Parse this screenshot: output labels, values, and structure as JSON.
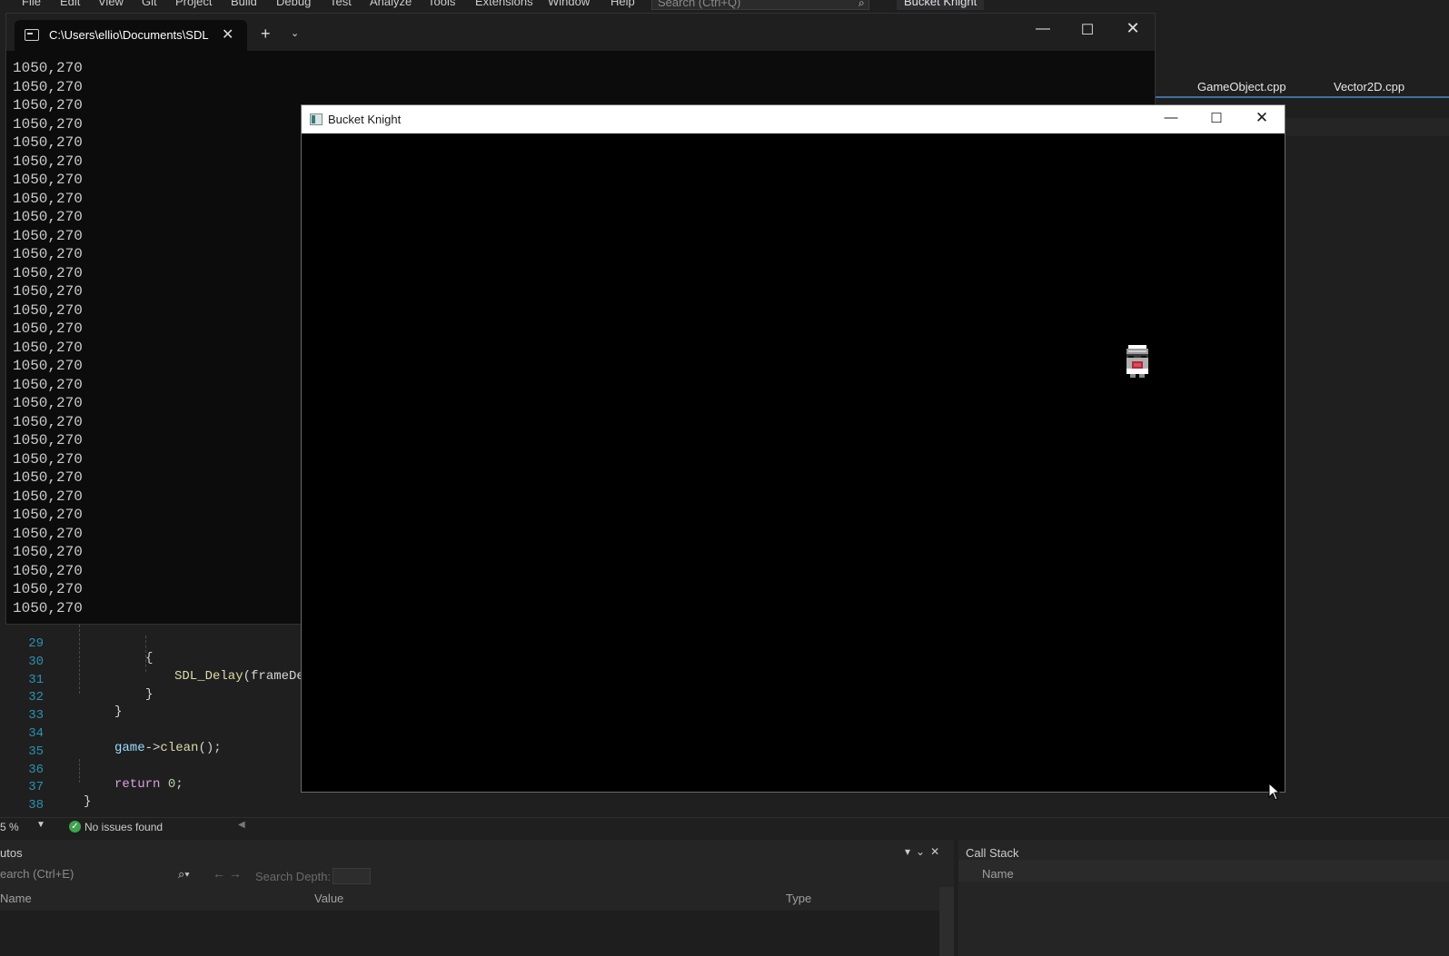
{
  "ide": {
    "menu": [
      "File",
      "Edit",
      "View",
      "Git",
      "Project",
      "Build",
      "Debug",
      "Test",
      "Analyze",
      "Tools",
      "Extensions",
      "Window",
      "Help"
    ],
    "search_placeholder": "Search (Ctrl+Q)",
    "solution_name": "Bucket Knight",
    "tabs": [
      "GameObject.cpp",
      "Vector2D.cpp"
    ],
    "code": {
      "line_numbers": [
        "29",
        "30",
        "31",
        "32",
        "33",
        "34",
        "35",
        "36",
        "37",
        "38"
      ],
      "open_brace_29": "{",
      "delay_call_fn": "SDL_Delay",
      "delay_call_arg": "(frameDe",
      "close_brace_31": "}",
      "close_brace_32": "}",
      "clean_obj": "game",
      "clean_arrow": "->",
      "clean_fn": "clean",
      "clean_tail": "();",
      "return_kw": "return",
      "return_val": "0",
      "return_semi": ";",
      "close_brace_37": "}"
    },
    "status": {
      "zoom": "5 %",
      "issues": "No issues found"
    },
    "autos": {
      "title": "utos",
      "search_placeholder": "earch (Ctrl+E)",
      "search_depth_label": "Search Depth:",
      "columns": [
        "Name",
        "Value",
        "Type"
      ]
    },
    "call_stack": {
      "title": "Call Stack",
      "columns": [
        "Name"
      ]
    }
  },
  "console": {
    "tab_title": "C:\\Users\\ellio\\Documents\\SDL",
    "lines": [
      "1050,270",
      "1050,270",
      "1050,270",
      "1050,270",
      "1050,270",
      "1050,270",
      "1050,270",
      "1050,270",
      "1050,270",
      "1050,270",
      "1050,270",
      "1050,270",
      "1050,270",
      "1050,270",
      "1050,270",
      "1050,270",
      "1050,270",
      "1050,270",
      "1050,270",
      "1050,270",
      "1050,270",
      "1050,270",
      "1050,270",
      "1050,270",
      "1050,270",
      "1050,270",
      "1050,270",
      "1050,270",
      "1050,270",
      "1050,270"
    ]
  },
  "game_window": {
    "title": "Bucket Knight",
    "background": "#000000"
  }
}
